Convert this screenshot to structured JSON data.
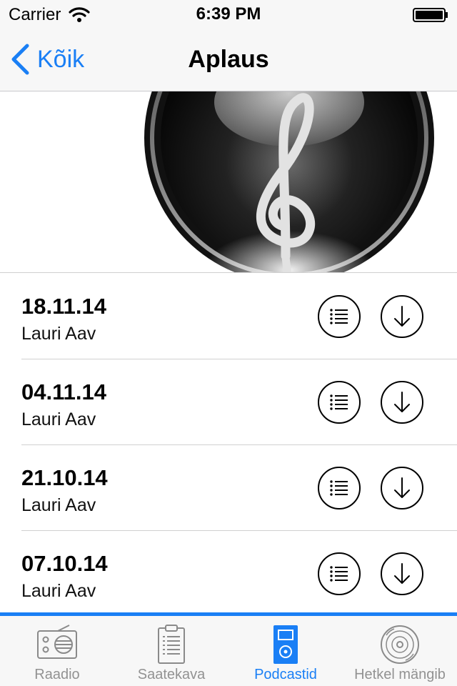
{
  "status_bar": {
    "carrier": "Carrier",
    "time": "6:39 PM",
    "icons": [
      "wifi-icon",
      "battery-icon"
    ]
  },
  "nav": {
    "back_label": "Kõik",
    "title": "Aplaus"
  },
  "artwork": {
    "icon": "treble-clef-icon"
  },
  "episodes": [
    {
      "date": "18.11.14",
      "author": "Lauri Aav"
    },
    {
      "date": "04.11.14",
      "author": "Lauri Aav"
    },
    {
      "date": "21.10.14",
      "author": "Lauri Aav"
    },
    {
      "date": "07.10.14",
      "author": "Lauri Aav"
    }
  ],
  "tabs": [
    {
      "label": "Raadio",
      "icon": "radio-icon",
      "active": false
    },
    {
      "label": "Saatekava",
      "icon": "schedule-icon",
      "active": false
    },
    {
      "label": "Podcastid",
      "icon": "ipod-icon",
      "active": true
    },
    {
      "label": "Hetkel mängib",
      "icon": "disc-icon",
      "active": false
    }
  ],
  "colors": {
    "accent": "#1a7ff5",
    "inactive": "#929292",
    "bar_background": "#f7f7f7"
  }
}
